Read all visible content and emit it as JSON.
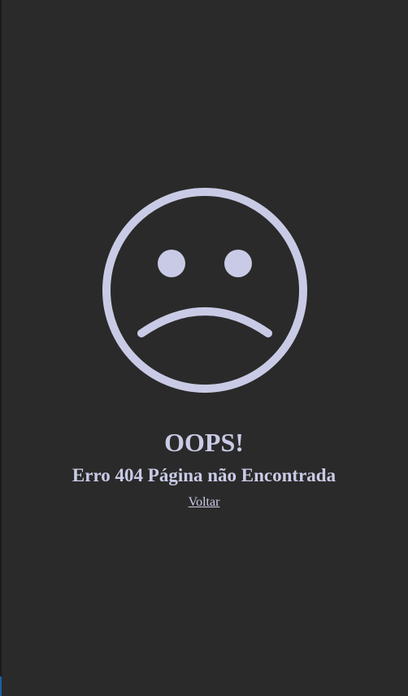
{
  "error_page": {
    "icon": "sad-face-icon",
    "heading": "OOPS!",
    "message": "Erro 404 Página não Encontrada",
    "back_link_label": "Voltar"
  },
  "colors": {
    "background": "#2a2a2a",
    "foreground": "#c9cbe6",
    "left_edge": "#1b1b1b",
    "left_edge_accent": "#1f5fa8"
  }
}
